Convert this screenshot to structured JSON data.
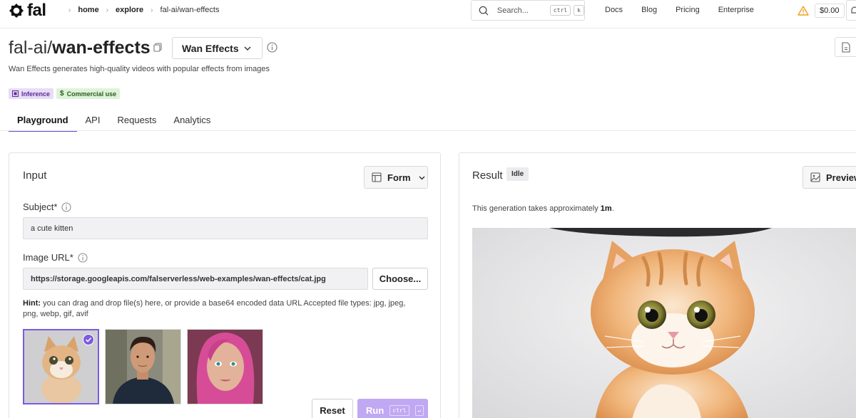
{
  "header": {
    "brand": "fal",
    "breadcrumbs": [
      "home",
      "explore",
      "fal-ai/wan-effects"
    ],
    "search": {
      "placeholder": "Search...",
      "shortcut_mod": "ctrl",
      "shortcut_key": "k"
    },
    "nav": [
      "Docs",
      "Blog",
      "Pricing",
      "Enterprise"
    ],
    "credit": "$0.00"
  },
  "model": {
    "owner": "fal-ai/",
    "name": "wan-effects",
    "endpoint": "Wan Effects",
    "description": "Wan Effects generates high-quality videos with popular effects from images",
    "badges": [
      "Inference",
      "Commercial use"
    ]
  },
  "tabs": [
    "Playground",
    "API",
    "Requests",
    "Analytics"
  ],
  "input": {
    "title": "Input",
    "mode": "Form",
    "subject_label": "Subject*",
    "subject_value": "a cute kitten",
    "image_url_label": "Image URL*",
    "image_url_value": "https://storage.googleapis.com/falserverless/web-examples/wan-effects/cat.jpg",
    "choose_label": "Choose...",
    "hint_label": "Hint:",
    "hint_text": "you can drag and drop file(s) here, or provide a base64 encoded data URL Accepted file types: jpg, jpeg, png, webp, gif, avif",
    "reset_label": "Reset",
    "run_label": "Run",
    "run_shortcut": "ctrl",
    "run_enter": "↵"
  },
  "result": {
    "title": "Result",
    "status": "Idle",
    "preview_label": "Preview",
    "note_prefix": "This generation takes approximately",
    "note_value": "1m",
    "note_suffix": "."
  },
  "colors": {
    "accent": "#6b48d6",
    "run_button": "#c1a8f3",
    "badge_inference_bg": "#e8dcf7",
    "badge_commercial_bg": "#ddf3d8",
    "warning": "#f0a11b"
  },
  "icons": [
    "fal-logo-icon",
    "search-icon",
    "warning-icon",
    "copy-icon",
    "chevron-down-icon",
    "info-icon",
    "document-icon",
    "form-icon",
    "image-icon",
    "check-icon"
  ]
}
